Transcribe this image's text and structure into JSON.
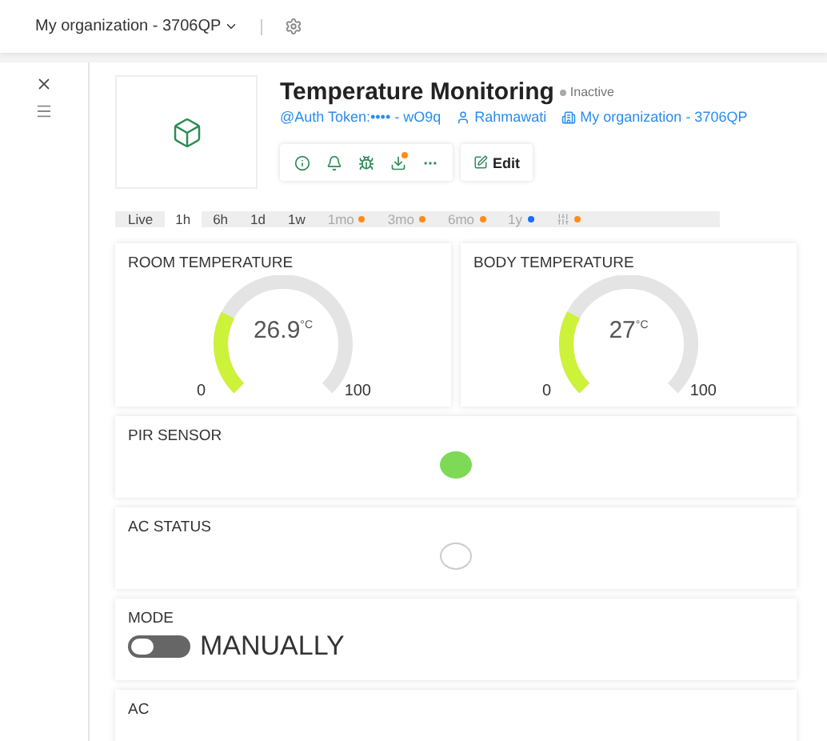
{
  "top_bar": {
    "organization": "My organization - 3706QP"
  },
  "device": {
    "title": "Temperature Monitoring",
    "status": "Inactive",
    "auth_token": "@Auth Token:•••• - wO9q",
    "owner": "Rahmawati",
    "organization": "My organization - 3706QP",
    "edit_label": "Edit",
    "actions": [
      {
        "kind": "info",
        "dot": false
      },
      {
        "kind": "bell",
        "dot": false
      },
      {
        "kind": "bug",
        "dot": false
      },
      {
        "kind": "download",
        "dot": true
      },
      {
        "kind": "more",
        "dot": false
      }
    ]
  },
  "time_ranges": [
    {
      "kind": "text",
      "label": "Live",
      "selected": false
    },
    {
      "kind": "text",
      "label": "1h",
      "selected": true
    },
    {
      "kind": "text",
      "label": "6h",
      "selected": false
    },
    {
      "kind": "text",
      "label": "1d",
      "selected": false
    },
    {
      "kind": "text",
      "label": "1w",
      "selected": false
    },
    {
      "kind": "text",
      "label": "1mo",
      "selected": false,
      "color": "#ff8c1a"
    },
    {
      "kind": "text",
      "label": "3mo",
      "selected": false,
      "color": "#ff8c1a"
    },
    {
      "kind": "text",
      "label": "6mo",
      "selected": false,
      "color": "#ff8c1a"
    },
    {
      "kind": "text",
      "label": "1y",
      "selected": false,
      "color": "#1a6dff"
    },
    {
      "kind": "icon",
      "selected": false,
      "color": "#ff8c1a"
    }
  ],
  "widgets": [
    {
      "kind": "gauge",
      "title": "ROOM TEMPERATURE",
      "value": "26.9",
      "unit": "°C",
      "min": "0",
      "max": "100",
      "level": 0.269
    },
    {
      "kind": "gauge",
      "title": "BODY TEMPERATURE",
      "value": "27",
      "unit": "°C",
      "min": "0",
      "max": "100",
      "level": 0.27
    },
    {
      "kind": "led",
      "title": "PIR SENSOR",
      "on": true
    },
    {
      "kind": "led",
      "title": "AC STATUS",
      "on": false
    },
    {
      "kind": "switch",
      "title": "MODE",
      "on": false,
      "label": "MANUALLY"
    },
    {
      "kind": "label",
      "title": "AC"
    }
  ]
}
